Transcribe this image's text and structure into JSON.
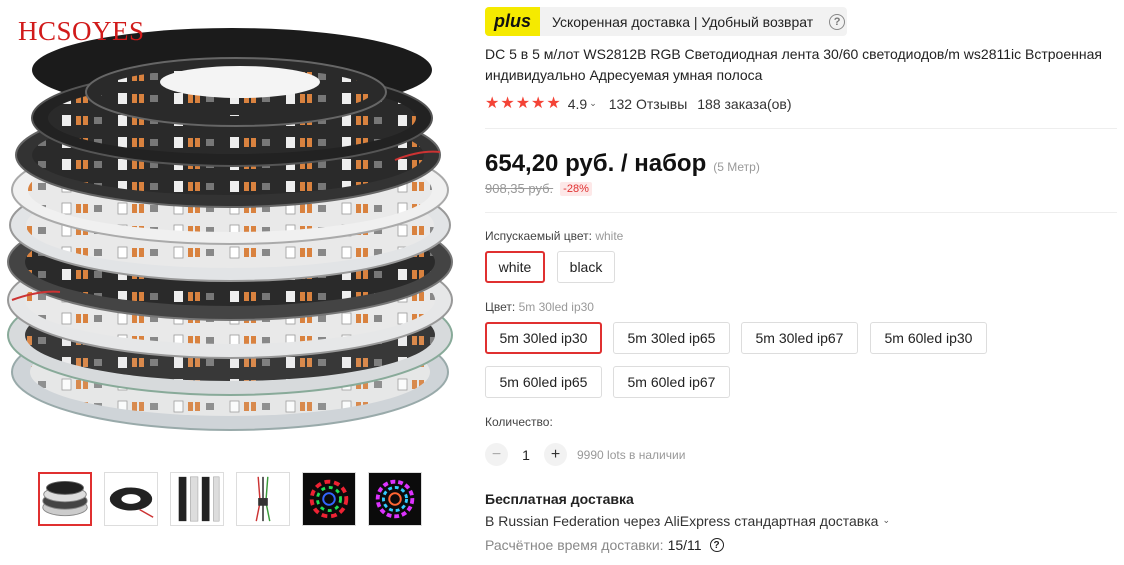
{
  "gallery": {
    "brand": "HCSOYES",
    "thumbnails": [
      {
        "name": "thumb-reels",
        "active": true
      },
      {
        "name": "thumb-reel-black",
        "active": false
      },
      {
        "name": "thumb-strips",
        "active": false
      },
      {
        "name": "thumb-connector",
        "active": false
      },
      {
        "name": "thumb-rgb-ring",
        "active": false
      },
      {
        "name": "thumb-rgb-ring-2",
        "active": false
      }
    ]
  },
  "plus": {
    "badge": "plus",
    "text": "Ускоренная доставка | Удобный возврат",
    "help": "?"
  },
  "product": {
    "title": "DC 5 в 5 м/лот WS2812B RGB Светодиодная лента 30/60 светодиодов/m ws2811ic Встроенная индивидуально Адресуемая умная полоса",
    "rating": "4.9",
    "reviews": "132 Отзывы",
    "orders": "188 заказа(ов)"
  },
  "price": {
    "current": "654,20 руб. / набор",
    "unit_note": "(5 Метр)",
    "old": "908,35 руб.",
    "discount": "-28%"
  },
  "options": {
    "color_label": "Испускаемый цвет:",
    "color_selected": "white",
    "colors": [
      "white",
      "black"
    ],
    "variant_label": "Цвет:",
    "variant_selected": "5m 30led ip30",
    "variants": [
      "5m 30led ip30",
      "5m 30led ip65",
      "5m 30led ip67",
      "5m 60led ip30",
      "5m 60led ip65",
      "5m 60led ip67"
    ]
  },
  "quantity": {
    "label": "Количество:",
    "minus": "−",
    "value": "1",
    "plus": "+",
    "stock": "9990 lots в наличии"
  },
  "shipping": {
    "title": "Бесплатная доставка",
    "line": "В Russian Federation через AliExpress стандартная доставка",
    "eta_label": "Расчётное время доставки:",
    "eta_date": "15/11",
    "help": "?"
  },
  "colors": {
    "accent": "#e03030",
    "plus_yellow": "#f5ea00",
    "star": "#f44336"
  },
  "icons": {
    "star": "★",
    "chevron": "⌄"
  }
}
